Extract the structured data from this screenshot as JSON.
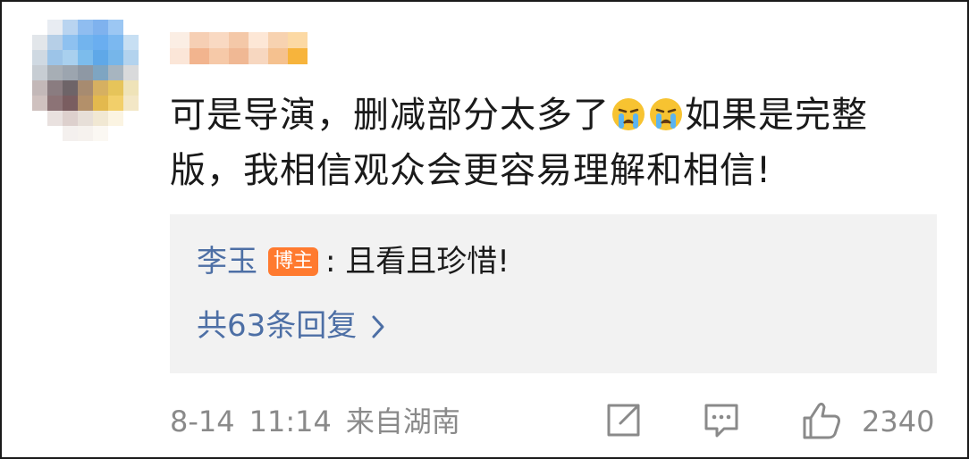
{
  "comment": {
    "text_part1": "可是导演，删减部分太多了",
    "emoji_name": "crying-emoji",
    "text_part2": "如果是完整版，我相信观众会更容易理解和相信!"
  },
  "reply": {
    "author": "李玉",
    "badge": "博主",
    "separator": ":",
    "text": "且看且珍惜!",
    "more_label": "共63条回复"
  },
  "meta": {
    "date": "8-14",
    "time": "11:14",
    "location": "来自湖南"
  },
  "actions": {
    "share_icon": "share-icon",
    "comment_icon": "comment-icon",
    "like_icon": "like-icon",
    "like_count": "2340"
  },
  "colors": {
    "link": "#4d6fa5",
    "badge": "#ff7a2f",
    "reply_bg": "#f2f2f2",
    "meta": "#8a8a8a"
  }
}
